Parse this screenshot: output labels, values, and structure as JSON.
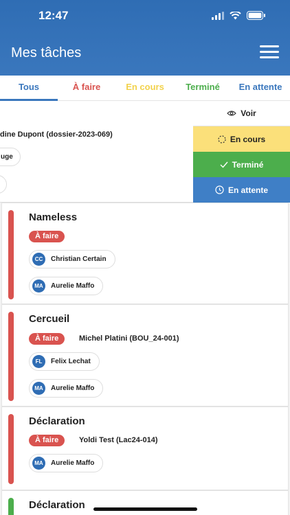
{
  "status_bar": {
    "time": "12:47"
  },
  "header": {
    "title": "Mes tâches",
    "menu_icon": "hamburger-menu-icon"
  },
  "tabs": [
    {
      "label": "Tous",
      "color": "#3a77bd",
      "active": true
    },
    {
      "label": "À faire",
      "color": "#d9534f"
    },
    {
      "label": "En cours",
      "color": "#f2d24b"
    },
    {
      "label": "Terminé",
      "color": "#4cae4c"
    },
    {
      "label": "En attente",
      "color": "#3a77bd"
    }
  ],
  "swiped_card": {
    "client": "dine Dupont (dossier-2023-069)",
    "chip_1": "uge",
    "actions": [
      {
        "label": "Voir",
        "icon": "eye-icon",
        "bg": "#ffffff",
        "color": "#222222"
      },
      {
        "label": "En cours",
        "icon": "spinner-icon",
        "bg": "#fbe07a",
        "color": "#222222"
      },
      {
        "label": "Terminé",
        "icon": "check-icon",
        "bg": "#4cae4c",
        "color": "#ffffff"
      },
      {
        "label": "En attente",
        "icon": "clock-icon",
        "bg": "#3f7fc6",
        "color": "#ffffff"
      }
    ]
  },
  "tasks": [
    {
      "title": "Nameless",
      "status": "À faire",
      "client": "",
      "assignees": [
        {
          "initials": "CC",
          "name": "Christian Certain"
        },
        {
          "initials": "MA",
          "name": "Aurelie Maffo"
        }
      ]
    },
    {
      "title": "Cercueil",
      "status": "À faire",
      "client": "Michel Platini (BOU_24-001)",
      "assignees": [
        {
          "initials": "FL",
          "name": "Felix Lechat"
        },
        {
          "initials": "MA",
          "name": "Aurelie Maffo"
        }
      ]
    },
    {
      "title": "Déclaration",
      "status": "À faire",
      "client": "Yoldi Test (Lac24-014)",
      "assignees": [
        {
          "initials": "MA",
          "name": "Aurelie Maffo"
        }
      ]
    },
    {
      "title": "Déclaration",
      "status": "",
      "client": "",
      "assignees": []
    }
  ]
}
